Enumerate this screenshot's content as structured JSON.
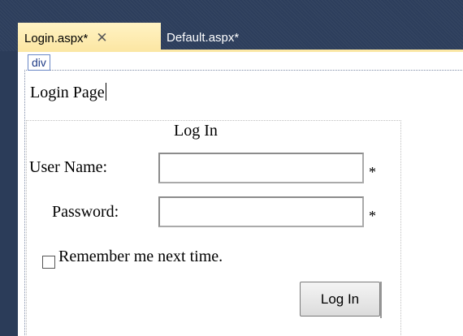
{
  "tabs": [
    {
      "label": "Login.aspx*",
      "close_icon": "close-icon"
    },
    {
      "label": "Default.aspx*"
    }
  ],
  "designer": {
    "element_tag": "div",
    "page_title": "Login Page"
  },
  "login_control": {
    "heading": "Log In",
    "username_label": "User Name:",
    "username_value": "",
    "password_label": "Password:",
    "password_value": "",
    "required_marker": "*",
    "remember_label": "Remember me next time.",
    "remember_checked": false,
    "login_button": "Log In"
  },
  "colors": {
    "tab_strip": "#2d3e5c",
    "active_tab": "#fce6a3",
    "designer_bg": "#ffffff"
  }
}
